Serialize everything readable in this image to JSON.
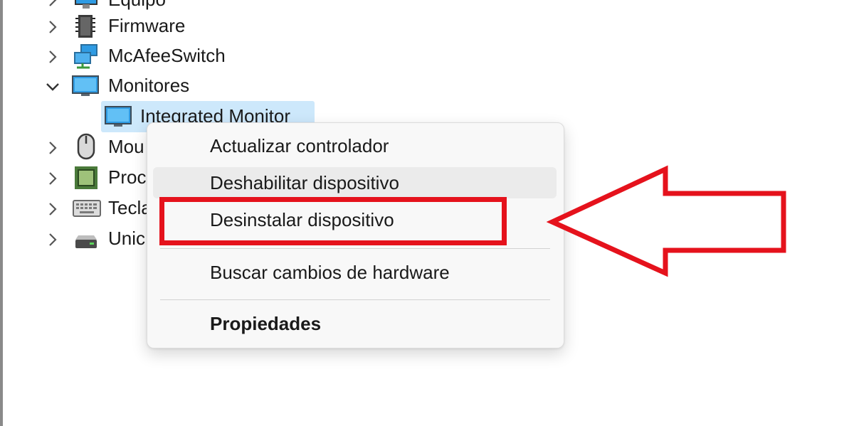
{
  "tree": {
    "items": [
      {
        "label": "Equipo",
        "expanded": false,
        "icon": "computer-icon"
      },
      {
        "label": "Firmware",
        "expanded": false,
        "icon": "firmware-chip-icon"
      },
      {
        "label": "McAfeeSwitch",
        "expanded": false,
        "icon": "network-adapter-icon"
      },
      {
        "label": "Monitores",
        "expanded": true,
        "icon": "monitor-icon"
      },
      {
        "label": "Integrated Monitor",
        "selected": true,
        "icon": "monitor-icon"
      },
      {
        "label": "Mou",
        "expanded": false,
        "icon": "mouse-icon"
      },
      {
        "label": "Proc",
        "expanded": false,
        "icon": "processor-icon"
      },
      {
        "label": "Tecla",
        "expanded": false,
        "icon": "keyboard-icon"
      },
      {
        "label": "Unic",
        "expanded": false,
        "icon": "disk-drive-icon"
      }
    ]
  },
  "context_menu": {
    "items": [
      {
        "label": "Actualizar controlador"
      },
      {
        "label": "Deshabilitar dispositivo",
        "hovered": true
      },
      {
        "label": "Desinstalar dispositivo",
        "highlighted": true
      },
      {
        "label": "Buscar cambios de hardware"
      },
      {
        "label": "Propiedades",
        "bold": true
      }
    ]
  },
  "annotation": {
    "box_color": "#e5121c",
    "arrow_color": "#e5121c",
    "arrow_direction": "left"
  },
  "colors": {
    "selection": "#cde8fb",
    "menu_background": "#f8f8f8",
    "menu_hover": "#ebebeb",
    "monitor_icon_blue": "#2f9be3"
  }
}
